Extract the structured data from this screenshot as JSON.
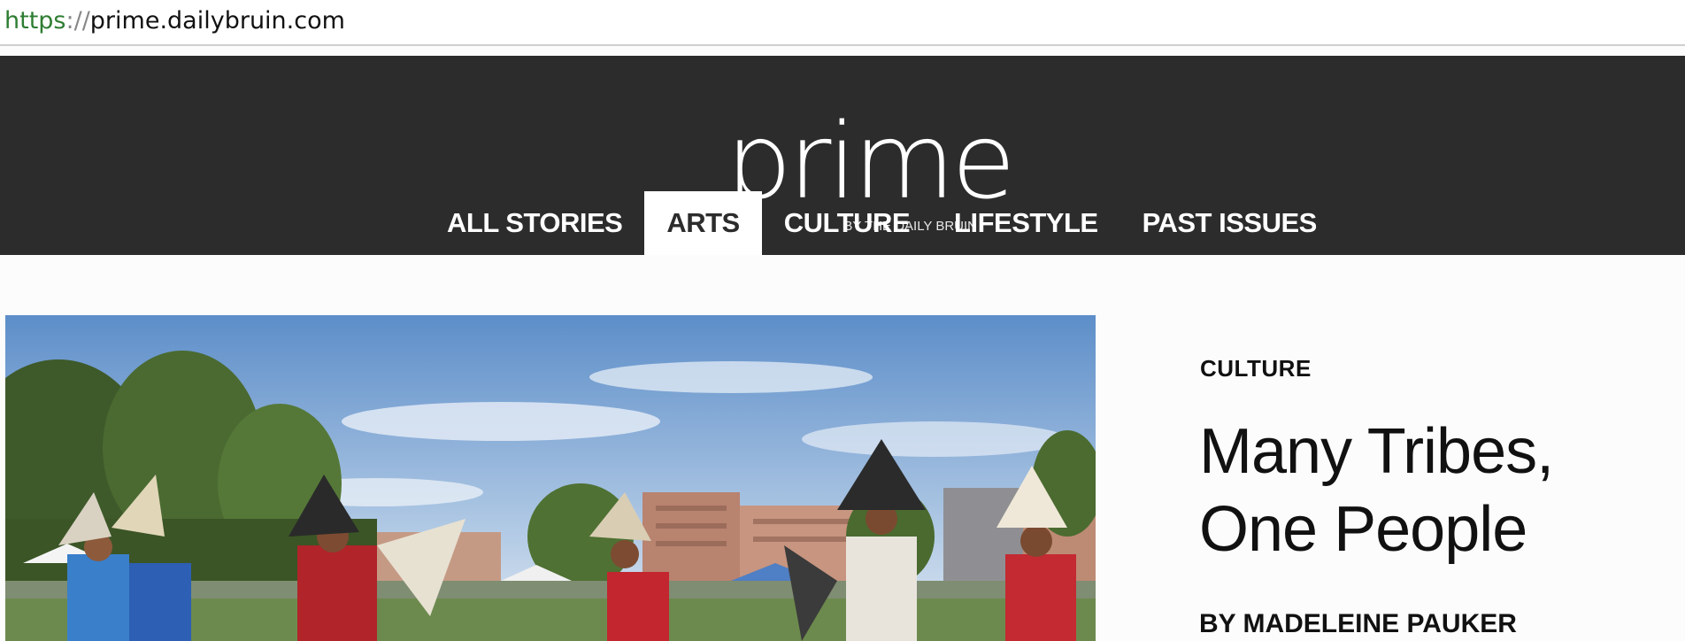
{
  "browser": {
    "url_scheme": "https",
    "url_sep": "://",
    "url_host": "prime.dailybruin.com"
  },
  "header": {
    "logo_word": "prime",
    "logo_sub": "BY THE DAILY BRUIN",
    "background": "#2c2c2c"
  },
  "nav": {
    "items": [
      {
        "label": "ALL STORIES"
      },
      {
        "label": "ARTS",
        "active": true
      },
      {
        "label": "CULTURE"
      },
      {
        "label": "LIFESTYLE"
      },
      {
        "label": "PAST ISSUES"
      }
    ]
  },
  "feature": {
    "category": "CULTURE",
    "headline": "Many Tribes, One People",
    "byline": "BY MADELEINE PAUKER",
    "image_icon": "pow-wow-dancers-photo"
  }
}
